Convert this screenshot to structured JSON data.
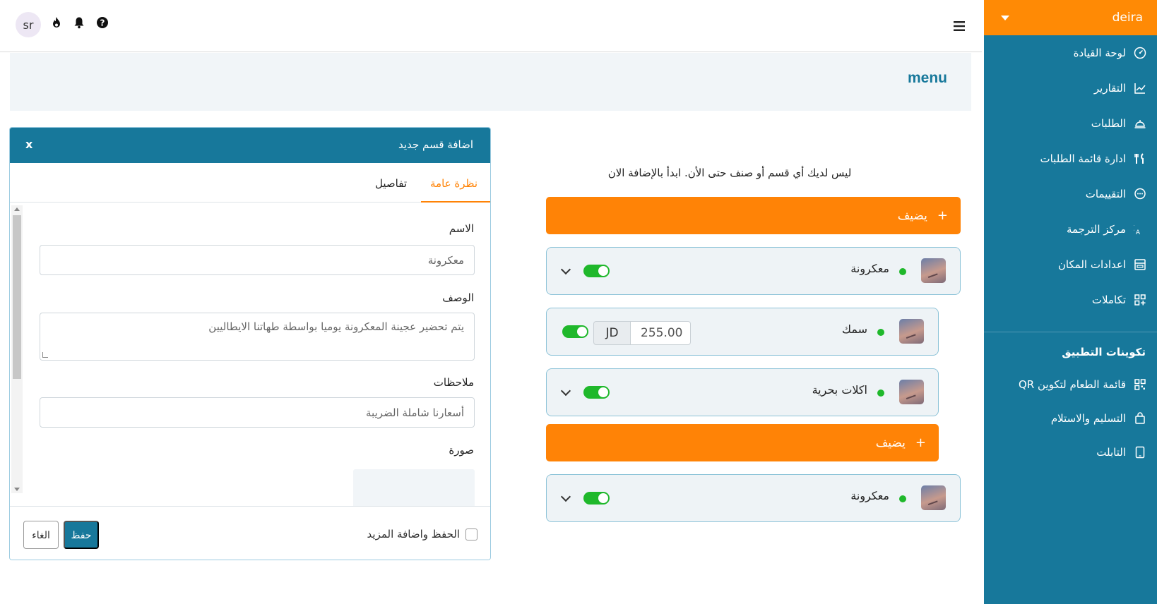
{
  "sidebar": {
    "venue": "deira",
    "items": [
      {
        "label": "لوحة القيادة",
        "icon": "gauge-icon"
      },
      {
        "label": "التقارير",
        "icon": "chart-line-icon"
      },
      {
        "label": "الطلبات",
        "icon": "bell-service-icon"
      },
      {
        "label": "ادارة قائمة الطلبات",
        "icon": "utensils-icon"
      },
      {
        "label": "التقييمات",
        "icon": "chat-bubble-icon"
      },
      {
        "label": "مركز الترجمة",
        "icon": "translate-icon"
      },
      {
        "label": "اعدادات المكان",
        "icon": "store-icon"
      },
      {
        "label": "تكاملات",
        "icon": "integrations-icon"
      }
    ],
    "section_title": "تكوينات التطبيق",
    "app_items": [
      {
        "label": "قائمة الطعام لتكوين QR",
        "icon": "qr-code-icon"
      },
      {
        "label": "التسليم والاستلام",
        "icon": "shopping-bag-icon"
      },
      {
        "label": "التابلت",
        "icon": "tablet-icon"
      }
    ]
  },
  "topbar": {
    "avatar_initials": "sr",
    "icons": [
      "fire-icon",
      "bell-icon",
      "help-icon"
    ],
    "menu_icon": "hamburger-icon"
  },
  "page": {
    "title": "menu"
  },
  "menu_list": {
    "empty_note": "ليس لديك أي قسم أو صنف حتى الأن. ابدأ بالإضافة الان",
    "add_label": "يضيف",
    "rows": [
      {
        "name": "معكرونة"
      },
      {
        "name": "سمك",
        "currency": "JD",
        "price": "255.00"
      },
      {
        "name": "اكلات بحرية"
      },
      {
        "name": "معكرونة"
      }
    ]
  },
  "modal": {
    "title": "اضافة قسم جديد",
    "close_label": "x",
    "tabs": [
      "نظرة عامة",
      "تفاصيل"
    ],
    "fields": {
      "name_label": "الاسم",
      "name_value": "معكرونة",
      "description_label": "الوصف",
      "description_value": "يتم تحضير عجينة المعكرونة يوميا بواسطة طهاتنا الايطاليين",
      "notes_label": "ملاحظات",
      "notes_value": "أسعارنا شاملة الضريبة",
      "image_label": "صورة"
    },
    "footer": {
      "save_more_label": "الحفظ واضافة المزيد",
      "save_label": "حفظ",
      "cancel_label": "الغاء"
    }
  },
  "colors": {
    "primary": "#17789b",
    "accent": "#ff8306",
    "toggle_on": "#1fb82b"
  }
}
